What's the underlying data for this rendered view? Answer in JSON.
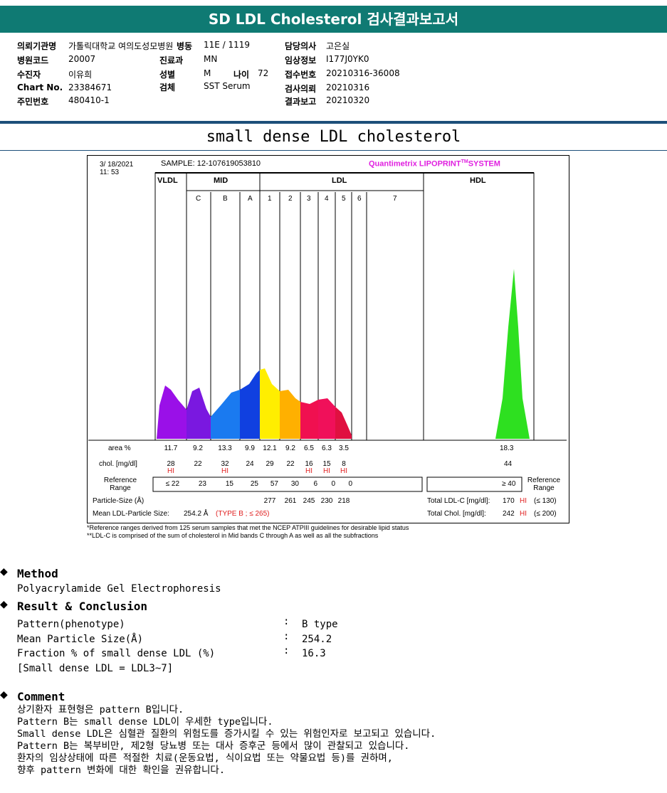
{
  "header": {
    "title": "SD LDL Cholesterol 검사결과보고서"
  },
  "patient": {
    "institution_label": "의뢰기관명",
    "institution": "가톨릭대학교 여의도성모병원",
    "ward_label": "병동",
    "ward": "11E / 1119",
    "doctor_label": "담당의사",
    "doctor": "고은실",
    "hospital_code_label": "병원코드",
    "hospital_code": "20007",
    "dept_label": "진료과",
    "dept": "MN",
    "clinical_label": "임상정보",
    "clinical": "I177J0YK0",
    "name_label": "수진자",
    "name": "이유희",
    "sex_label": "성별",
    "sex": "M",
    "age_label": "나이",
    "age": "72",
    "receipt_label": "접수번호",
    "receipt": "20210316-36008",
    "chart_label": "Chart No.",
    "chart": "23384671",
    "specimen_label": "검체",
    "specimen": "SST Serum",
    "request_label": "검사의뢰",
    "request": "20210316",
    "id_label": "주민번호",
    "id": "480410-1",
    "report_label": "결과보고",
    "report": "20210320"
  },
  "subtitle": "small dense LDL cholesterol",
  "chart": {
    "date": "3/ 18/2021",
    "time": "11: 53",
    "sample": "SAMPLE:   12-107619053810",
    "brand": "Quantimetrix LIPOPRINT",
    "tm": "TM",
    "system": "SYSTEM",
    "groups": [
      "VLDL",
      "MID",
      "LDL",
      "HDL"
    ],
    "bands": [
      "C",
      "B",
      "A",
      "1",
      "2",
      "3",
      "4",
      "5",
      "6",
      "7"
    ],
    "row_labels": {
      "area": "area %",
      "chol": "chol. [mg/dl]",
      "ref": "Reference Range",
      "ref_right": "Reference Range",
      "particle": "Particle-Size (Å)"
    },
    "area": [
      "11.7",
      "9.2",
      "13.3",
      "9.9",
      "12.1",
      "9.2",
      "6.5",
      "6.3",
      "3.5"
    ],
    "chol": [
      "28",
      "22",
      "32",
      "24",
      "29",
      "22",
      "16",
      "15",
      "8"
    ],
    "chol_flags": [
      "HI",
      "",
      "HI",
      "",
      "",
      "",
      "HI",
      "HI",
      "HI"
    ],
    "ref": [
      "≤ 22",
      "23",
      "15",
      "25",
      "57",
      "30",
      "6",
      "0",
      "0"
    ],
    "particle": [
      "277",
      "261",
      "245",
      "230",
      "218"
    ],
    "hdl_area": "18.3",
    "hdl_chol": "44",
    "hdl_ref": "≥ 40",
    "mean_label": "Mean LDL-Particle Size:",
    "mean_value": "254.2 Å",
    "mean_type": "(TYPE B ; ≤ 265)",
    "total_ldl_label": "Total LDL-C [mg/dl]:",
    "total_ldl": "170",
    "total_ldl_flag": "HI",
    "total_ldl_ref": "(≤ 130)",
    "total_chol_label": "Total Chol. [mg/dl]:",
    "total_chol": "242",
    "total_chol_flag": "HI",
    "total_chol_ref": "(≤ 200)",
    "foot1": "*Reference ranges derived from 125 serum samples that met the NCEP ATPIII guidelines for desirable lipid status",
    "foot2": "**LDL-C is comprised of the sum of cholesterol in Mid bands C through A as well as all the subfractions"
  },
  "method": {
    "title": "Method",
    "text": "Polyacrylamide Gel Electrophoresis"
  },
  "result": {
    "title": "Result & Conclusion",
    "rows": [
      {
        "k": "Pattern(phenotype)",
        "v": "B type"
      },
      {
        "k": "Mean Particle Size(Å)",
        "v": "254.2"
      },
      {
        "k": "Fraction % of small dense LDL (%)",
        "v": "16.3"
      }
    ],
    "note": "[Small dense LDL = LDL3~7]",
    "sep": ":"
  },
  "comment": {
    "title": "Comment",
    "lines": [
      "상기환자 표현형은 pattern B입니다.",
      "Pattern B는 small dense LDL이 우세한 type입니다.",
      "Small dense LDL은 심혈관 질환의 위험도를 증가시킬 수 있는 위험인자로 보고되고 있습니다.",
      "Pattern B는 복부비만, 제2형 당뇨병 또는 대사 증후군 등에서 많이 관찰되고 있습니다.",
      "환자의 임상상태에 따른 적절한 치료(운동요법, 식이요법 또는 약물요법 등)를 권하며,",
      "향후 pattern 변화에 대한 확인을 권유합니다."
    ]
  }
}
